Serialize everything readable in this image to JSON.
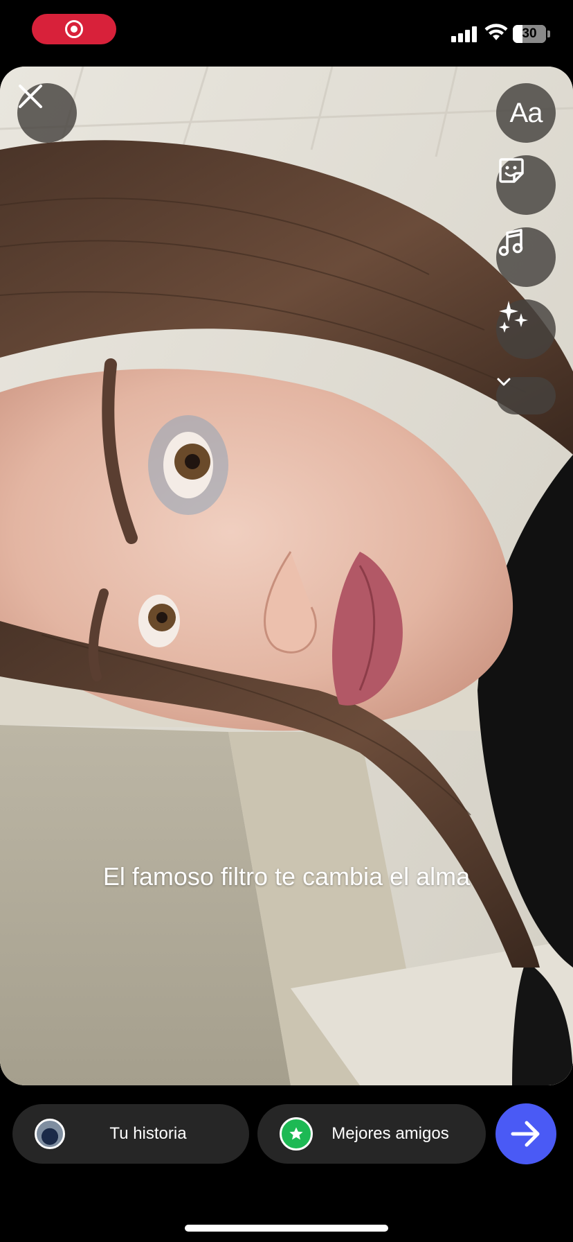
{
  "status_bar": {
    "recording": true,
    "battery_level": "30",
    "signal_bars": 4,
    "wifi": true
  },
  "editor": {
    "close_icon": "close-icon",
    "tools": [
      {
        "name": "text-tool",
        "label": "Aa"
      },
      {
        "name": "sticker-tool",
        "icon": "sticker-icon"
      },
      {
        "name": "music-tool",
        "icon": "music-note-icon"
      },
      {
        "name": "effects-tool",
        "icon": "sparkles-icon"
      },
      {
        "name": "more-tools",
        "icon": "chevron-down-icon"
      }
    ],
    "caption": "El famoso filtro te cambia el alma"
  },
  "share_bar": {
    "your_story_label": "Tu historia",
    "close_friends_label": "Mejores amigos",
    "send_icon": "arrow-right-icon"
  },
  "colors": {
    "recording_pill": "#d8213a",
    "close_friends_green": "#1db954",
    "send_button": "#4a5af5",
    "button_background": "#262626"
  }
}
